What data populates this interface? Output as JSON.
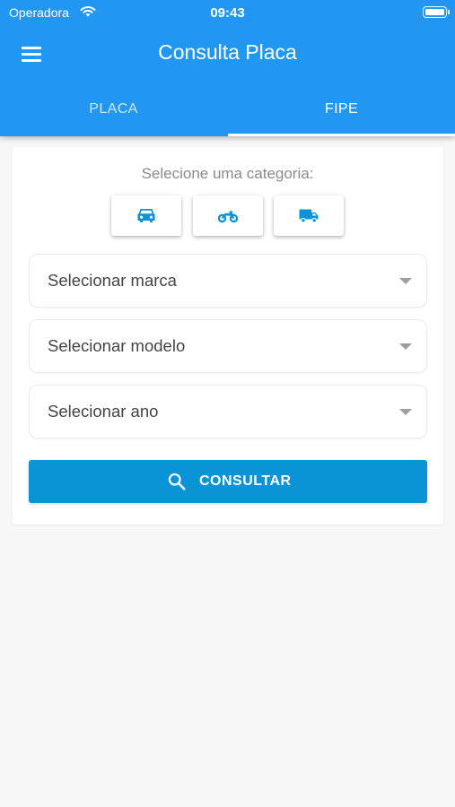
{
  "status_bar": {
    "carrier": "Operadora",
    "time": "09:43"
  },
  "app_bar": {
    "title": "Consulta Placa"
  },
  "tabs": [
    {
      "label": "PLACA",
      "selected": false
    },
    {
      "label": "FIPE",
      "selected": true
    }
  ],
  "fipe": {
    "category_prompt": "Selecione uma categoria:",
    "categories": [
      {
        "icon": "car-icon"
      },
      {
        "icon": "motorcycle-icon"
      },
      {
        "icon": "truck-icon"
      }
    ],
    "selects": {
      "marca": "Selecionar marca",
      "modelo": "Selecionar modelo",
      "ano": "Selecionar ano"
    },
    "consult_button": "CONSULTAR"
  },
  "colors": {
    "app_bar": "#2196f3",
    "icon_accent": "#0a93d6",
    "button": "#0a93d6",
    "background": "#f7f7f7"
  }
}
